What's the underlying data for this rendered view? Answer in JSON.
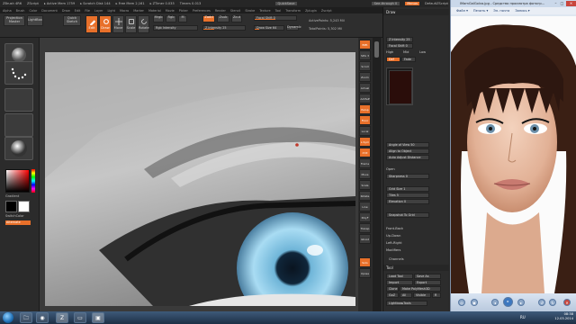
{
  "zbrush": {
    "title_items": [
      "ZBrush 4R6",
      "ZScript",
      "▸ Active Mem 1759",
      "▸ Scratch Disk 144",
      "▸ Free Mem 2,161",
      "▸ ZTimer 0.035",
      "Timers 0.013"
    ],
    "quicksave": "QuickSave",
    "see_through": "See-through 0",
    "menus_label": "Menus",
    "default_zscript": "DefaultZScript",
    "menu_items": [
      "Alpha",
      "Brush",
      "Color",
      "Document",
      "Draw",
      "Edit",
      "File",
      "Layer",
      "Light",
      "Macro",
      "Marker",
      "Material",
      "Movie",
      "Picker",
      "Preferences",
      "Render",
      "Stencil",
      "Stroke",
      "Texture",
      "Tool",
      "Transform",
      "Zplugin",
      "Zscript"
    ],
    "shelf": {
      "projection_master": "Projection Master",
      "lightbox": "LightBox",
      "quick_sketch": "Quick Sketch",
      "edit": "Edit",
      "draw": "Draw",
      "move": "Move",
      "scale": "Scale",
      "rotate": "Rotate",
      "mrgb": "Mrgb",
      "rgb": "Rgb",
      "m": "M",
      "zadd": "Zadd",
      "zsub": "Zsub",
      "zcut": "Zcut",
      "rgb_intensity": "Rgb Intensity",
      "z_intensity": "Z Intensity 25",
      "focal_shift": "Focal Shift 0",
      "draw_size": "Draw Size 64",
      "dynamic": "Dynamic",
      "active_points": "ActivePoints: 5,243 Mil",
      "total_points": "TotalPoints: 5,302 Mil"
    },
    "coords": "0.677,0.952,0.667",
    "left": {
      "gradient": "Gradient",
      "switch_color": "SwitchColor",
      "alternate": "Alternate"
    },
    "right_shelf": [
      "BPR",
      "SPix 3",
      "Scroll",
      "Zoom",
      "Actual",
      "AAHalf",
      "Persp",
      "Floor",
      "Local",
      "L.Sym",
      "XYZ",
      "Frame",
      "Move",
      "Scale",
      "Rotate",
      "Line Fill",
      "PolyF",
      "Transp",
      "Ghost",
      "Solo",
      "Xpose"
    ],
    "palette": {
      "draw_header": "Draw",
      "z_intensity": "Z Intensity 25",
      "focal_shift": "Focal Shift 0",
      "high": "High",
      "mid": "Mid",
      "low": "Low",
      "def": "Def",
      "fade": "Fade",
      "angle_of_view": "Angle of View 50",
      "align_to_object": "Align to Object",
      "auto_adjust": "Auto Adjust Distance",
      "open": "Open",
      "sharpness": "Sharpness 0",
      "grid_size": "Grid Size 1",
      "tiles": "Tiles 5",
      "elevation": "Elevation 0",
      "snapshot_to_grid": "Snapshot To Grid",
      "front_back": "Front-Back",
      "up_down": "Up-Down",
      "left_right": "Left-Right",
      "modifiers": "Modifiers",
      "channels": "Channels",
      "tool_header": "Tool",
      "load_tool": "Load Tool",
      "save_as": "Save As",
      "import": "Import",
      "export": "Export",
      "clone": "Clone",
      "make_polymesh": "Make PolyMesh3D",
      "goz": "GoZ",
      "all": "All",
      "visible": "Visible",
      "r": "R",
      "lightbox_tools": "Lightbox▸Tools"
    }
  },
  "viewer": {
    "title": "IMamGalGolva.jpg - Средство просмотра фотогр...",
    "menus": [
      "Файл ▾",
      "Печать ▾",
      "Эл. почта",
      "Запись ▾"
    ]
  },
  "taskbar": {
    "time": "08:38",
    "date": "12.03.2014",
    "lang": "RU"
  },
  "colors": {
    "accent": "#e8702a",
    "zbrush_bg": "#2c2c2c",
    "taskbar": "#1d2f45"
  }
}
